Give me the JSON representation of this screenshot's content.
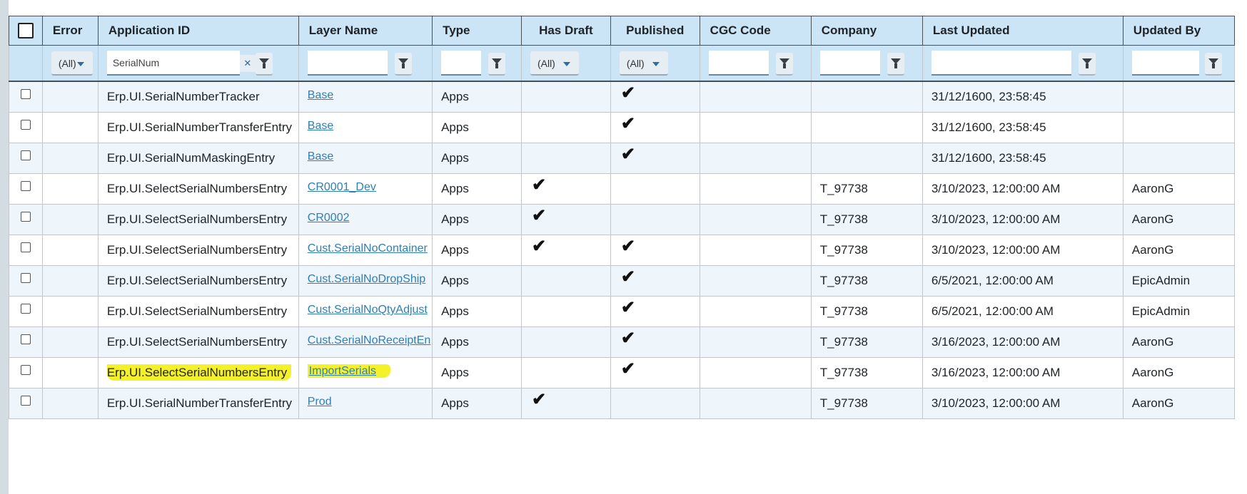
{
  "columns": [
    {
      "key": "select",
      "label": ""
    },
    {
      "key": "error",
      "label": "Error"
    },
    {
      "key": "app_id",
      "label": "Application ID"
    },
    {
      "key": "layer",
      "label": "Layer Name"
    },
    {
      "key": "type",
      "label": "Type"
    },
    {
      "key": "draft",
      "label": "Has Draft"
    },
    {
      "key": "published",
      "label": "Published"
    },
    {
      "key": "cgc",
      "label": "CGC Code"
    },
    {
      "key": "company",
      "label": "Company"
    },
    {
      "key": "updated",
      "label": "Last Updated"
    },
    {
      "key": "updated_by",
      "label": "Updated By"
    }
  ],
  "filters": {
    "error": "(All)",
    "app_id": "SerialNum",
    "draft": "(All)",
    "published": "(All)"
  },
  "icons": {
    "check": "checkmark-icon",
    "filter": "funnel-icon",
    "dropdown": "caret-down-icon",
    "clear": "clear-filter-icon"
  },
  "highlight_color": "#f4f02a",
  "rows": [
    {
      "app_id": "Erp.UI.SerialNumberTracker",
      "layer": "Base",
      "type": "Apps",
      "draft": false,
      "published": true,
      "company": "",
      "updated": "31/12/1600, 23:58:45",
      "updated_by": ""
    },
    {
      "app_id": "Erp.UI.SerialNumberTransferEntry",
      "layer": "Base",
      "type": "Apps",
      "draft": false,
      "published": true,
      "company": "",
      "updated": "31/12/1600, 23:58:45",
      "updated_by": ""
    },
    {
      "app_id": "Erp.UI.SerialNumMaskingEntry",
      "layer": "Base",
      "type": "Apps",
      "draft": false,
      "published": true,
      "company": "",
      "updated": "31/12/1600, 23:58:45",
      "updated_by": ""
    },
    {
      "app_id": "Erp.UI.SelectSerialNumbersEntry",
      "layer": "CR0001_Dev",
      "type": "Apps",
      "draft": true,
      "published": false,
      "company": "T_97738",
      "updated": "3/10/2023, 12:00:00 AM",
      "updated_by": "AaronG"
    },
    {
      "app_id": "Erp.UI.SelectSerialNumbersEntry",
      "layer": "CR0002",
      "type": "Apps",
      "draft": true,
      "published": false,
      "company": "T_97738",
      "updated": "3/10/2023, 12:00:00 AM",
      "updated_by": "AaronG"
    },
    {
      "app_id": "Erp.UI.SelectSerialNumbersEntry",
      "layer": "Cust.SerialNoContainer",
      "type": "Apps",
      "draft": true,
      "published": true,
      "company": "T_97738",
      "updated": "3/10/2023, 12:00:00 AM",
      "updated_by": "AaronG"
    },
    {
      "app_id": "Erp.UI.SelectSerialNumbersEntry",
      "layer": "Cust.SerialNoDropShip",
      "type": "Apps",
      "draft": false,
      "published": true,
      "company": "T_97738",
      "updated": "6/5/2021, 12:00:00 AM",
      "updated_by": "EpicAdmin"
    },
    {
      "app_id": "Erp.UI.SelectSerialNumbersEntry",
      "layer": "Cust.SerialNoQtyAdjust",
      "type": "Apps",
      "draft": false,
      "published": true,
      "company": "T_97738",
      "updated": "6/5/2021, 12:00:00 AM",
      "updated_by": "EpicAdmin"
    },
    {
      "app_id": "Erp.UI.SelectSerialNumbersEntry",
      "layer": "Cust.SerialNoReceiptEn",
      "type": "Apps",
      "draft": false,
      "published": true,
      "company": "T_97738",
      "updated": "3/16/2023, 12:00:00 AM",
      "updated_by": "AaronG"
    },
    {
      "app_id": "Erp.UI.SelectSerialNumbersEntry",
      "layer": "ImportSerials",
      "type": "Apps",
      "draft": false,
      "published": true,
      "company": "T_97738",
      "updated": "3/16/2023, 12:00:00 AM",
      "updated_by": "AaronG",
      "highlighted": true
    },
    {
      "app_id": "Erp.UI.SerialNumberTransferEntry",
      "layer": "Prod",
      "type": "Apps",
      "draft": true,
      "published": false,
      "company": "T_97738",
      "updated": "3/10/2023, 12:00:00 AM",
      "updated_by": "AaronG"
    }
  ]
}
